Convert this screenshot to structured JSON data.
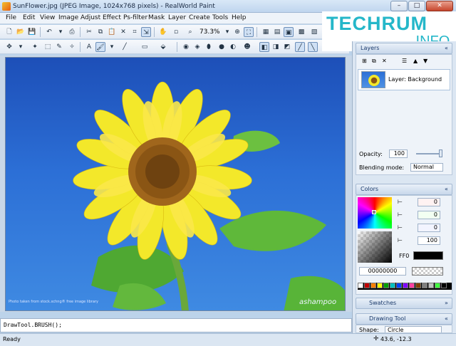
{
  "window": {
    "title": "SunFlower.jpg (JPEG Image, 1024x768 pixels) - RealWorld Paint",
    "min": "–",
    "max": "□",
    "close": "✕"
  },
  "menu": [
    "File",
    "Edit",
    "View",
    "Image",
    "Adjust",
    "Effect",
    "Ps-filter",
    "Mask",
    "Layer",
    "Create",
    "Tools",
    "Help"
  ],
  "toolbar": {
    "zoom": "73.3%"
  },
  "logo": {
    "line1": "TECHRUM",
    "line2": ".INFO"
  },
  "canvas": {
    "credit": "Photo taken from stock.xchng® free image library",
    "watermark": "ashampoo"
  },
  "script": {
    "text": "DrawTool.BRUSH();"
  },
  "status": {
    "text": "Ready",
    "coords": "43.6, -12.3"
  },
  "layers": {
    "title": "Layers",
    "layer_name": "Layer: Background",
    "opacity_label": "Opacity:",
    "opacity": "100",
    "blend_label": "Blending mode:",
    "blend_value": "Normal"
  },
  "colors": {
    "title": "Colors",
    "r": "0",
    "g": "0",
    "b": "0",
    "a": "100",
    "prefix": "FF0",
    "hex": "00000000"
  },
  "swatches": {
    "title": "Swatches",
    "colors": [
      "#000000",
      "#ffffff",
      "#c00000",
      "#ff8000",
      "#ffff00",
      "#00a000",
      "#00c0c0",
      "#0040ff",
      "#8000ff",
      "#ff40a0",
      "#804000",
      "#808080",
      "#c0c0c0",
      "#40ff40"
    ]
  },
  "drawing": {
    "title": "Drawing Tool",
    "shape_label": "Shape:",
    "shape_value": "Circle"
  }
}
